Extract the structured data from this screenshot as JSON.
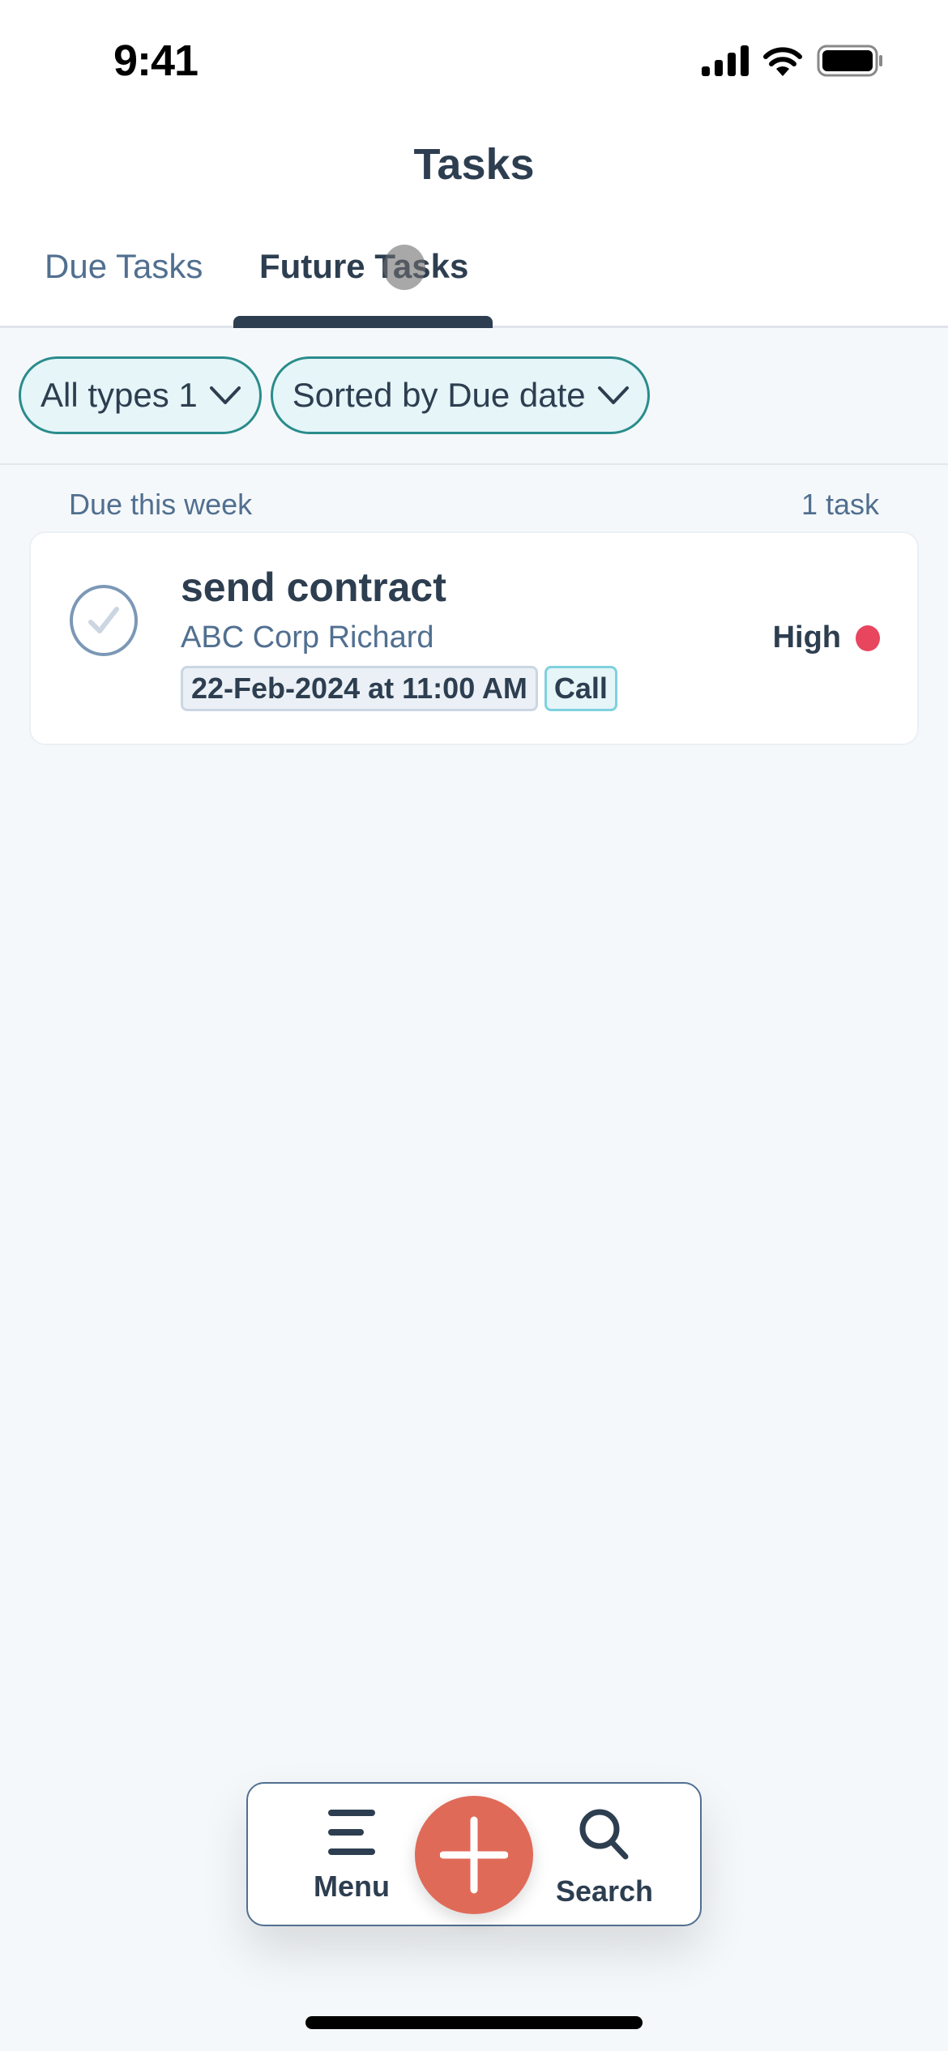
{
  "status_bar": {
    "time": "9:41"
  },
  "header": {
    "title": "Tasks",
    "tabs": [
      {
        "label": "Due Tasks",
        "active": false
      },
      {
        "label": "Future Tasks",
        "active": true
      }
    ]
  },
  "filters": [
    {
      "label": "All types 1",
      "icon": "chevron-down-icon"
    },
    {
      "label": "Sorted by Due date",
      "icon": "chevron-down-icon"
    }
  ],
  "section": {
    "label": "Due this week",
    "count": "1 task"
  },
  "tasks": [
    {
      "title": "send contract",
      "subtitle": "ABC Corp Richard",
      "due": "22-Feb-2024 at 11:00 AM",
      "type": "Call",
      "priority": "High",
      "priority_color": "#e8455f",
      "completed": false
    }
  ],
  "bottom_nav": {
    "menu_label": "Menu",
    "search_label": "Search",
    "fab_icon": "plus-icon",
    "fab_color": "#e06a58"
  }
}
